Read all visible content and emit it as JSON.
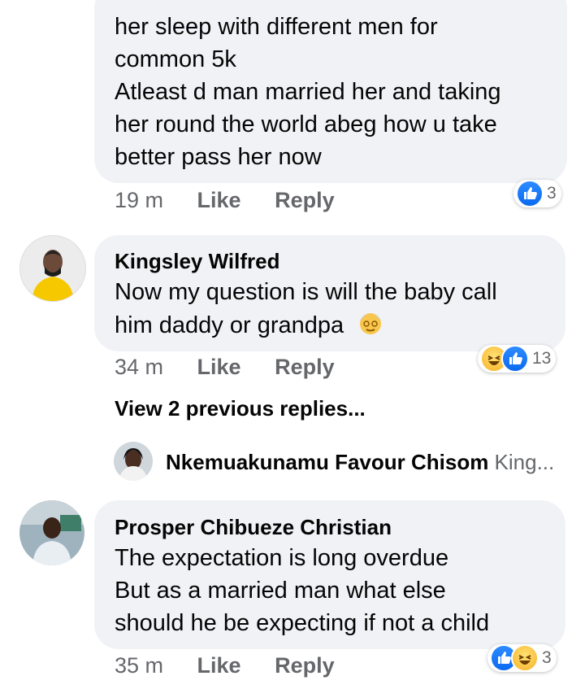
{
  "comments": [
    {
      "lines": [
        "her sleep with different men for",
        "common 5k",
        "Atleast d man married her and taking",
        "her round the world abeg how u take",
        "better pass her now"
      ],
      "time": "19 m",
      "like": "Like",
      "reply": "Reply",
      "reactions_count": "3"
    },
    {
      "author": "Kingsley Wilfred",
      "lines": [
        "Now my question is will the baby call",
        "him daddy or grandpa"
      ],
      "time": "34 m",
      "like": "Like",
      "reply": "Reply",
      "reactions_count": "13",
      "view_previous": "View 2 previous replies...",
      "reply_preview": {
        "author": "Nkemuakunamu Favour Chisom",
        "snippet": "King..."
      }
    },
    {
      "author": "Prosper Chibueze Christian",
      "lines": [
        "The expectation is long overdue",
        "But as a married man what else",
        "should he be expecting if not a child"
      ],
      "time": "35 m",
      "like": "Like",
      "reply": "Reply",
      "reactions_count": "3"
    }
  ],
  "icons": {
    "like": "thumbs-up-icon",
    "haha": "laughing-face-icon",
    "emoji": "older-person-emoji"
  },
  "colors": {
    "bubble": "#f0f2f5",
    "meta": "#65676b",
    "like_blue": "#1877f2"
  }
}
